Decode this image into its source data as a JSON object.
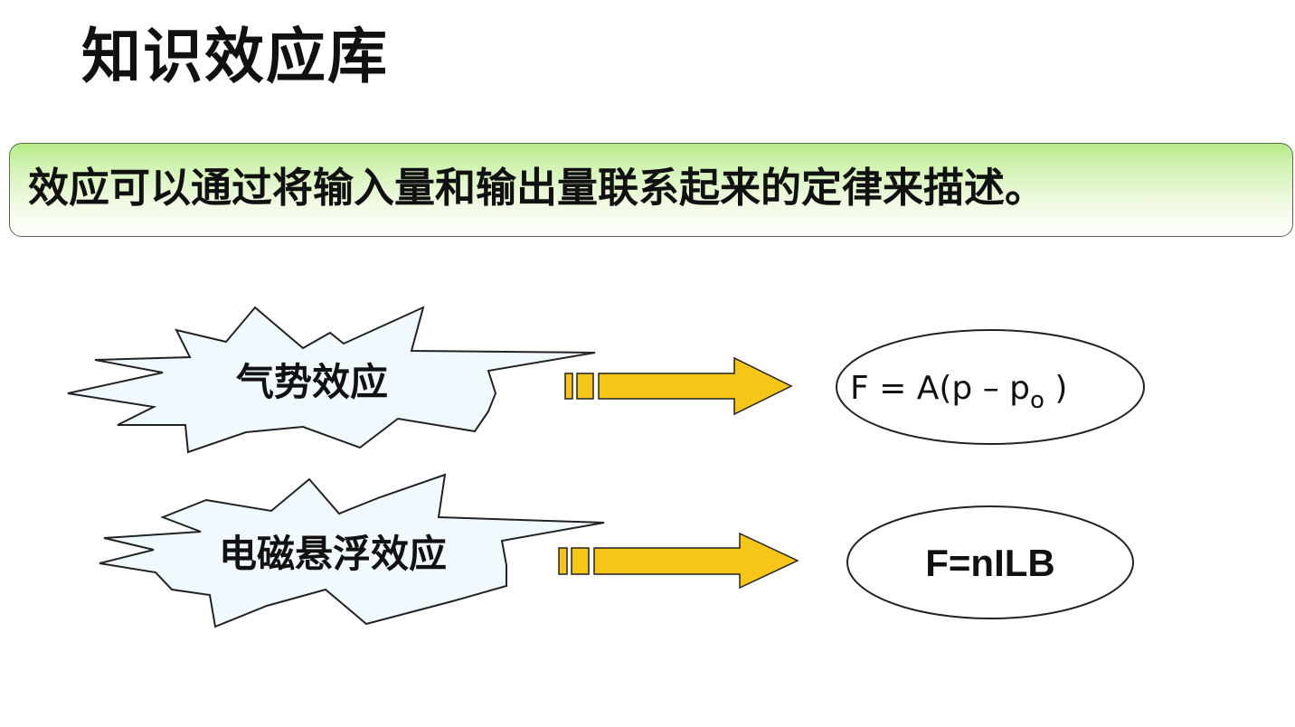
{
  "title": "知识效应库",
  "banner": {
    "text": "效应可以通过将输入量和输出量联系起来的定律来描述。"
  },
  "effects": [
    {
      "name": "气势效应",
      "formula": "F = A(p – p",
      "formula_sub": "o",
      "formula_tail": " )"
    },
    {
      "name": "电磁悬浮效应",
      "formula": "F=nILB"
    }
  ],
  "colors": {
    "banner_top": "#b6ec86",
    "burst_fill": "#f0fafe",
    "arrow_fill": "#f5c518",
    "outline": "#222222"
  }
}
